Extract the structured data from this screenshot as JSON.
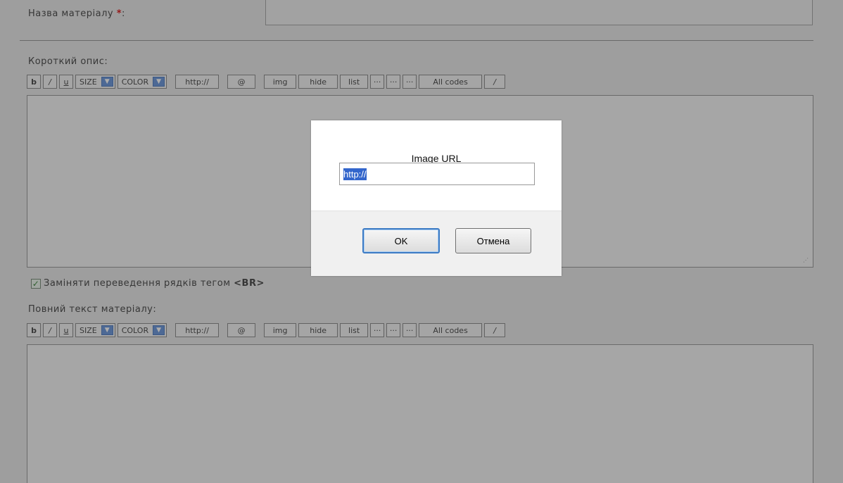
{
  "form": {
    "title_label": "Назва матеріалу ",
    "required_mark": "*",
    "title_colon": ":",
    "short_desc_label": "Короткий опис:",
    "full_text_label": "Повний текст матеріалу:",
    "replace_br": {
      "checked": true,
      "label_prefix": "Заміняти переведення рядків тегом ",
      "label_tag": "<BR>"
    }
  },
  "toolbar": {
    "bold": "b",
    "italic": "/",
    "underline": "u",
    "size": "SIZE",
    "color": "COLOR",
    "url": "http://",
    "email": "@",
    "img": "img",
    "hide": "hide",
    "list": "list",
    "dots1": "···",
    "dots2": "···",
    "dots3": "···",
    "all_codes": "All codes",
    "close": "/"
  },
  "dialog": {
    "label": "Image URL",
    "input_value": "http://",
    "ok_label": "OK",
    "cancel_label": "Отмена"
  },
  "colors": {
    "overlay": "#3c3c3c",
    "dropdown_accent": "#5b8bd6",
    "selection": "#3366cc",
    "required": "#d60000"
  }
}
